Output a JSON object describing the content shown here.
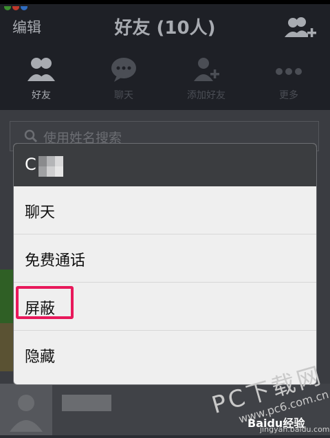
{
  "header": {
    "edit_label": "编辑",
    "title": "好友 (10人)",
    "add_friend_icon": "add-friend-icon"
  },
  "tabs": [
    {
      "label": "好友",
      "icon": "friends-icon",
      "active": true
    },
    {
      "label": "聊天",
      "icon": "chat-bubble-icon",
      "active": false
    },
    {
      "label": "添加好友",
      "icon": "add-friend-icon",
      "active": false
    },
    {
      "label": "更多",
      "icon": "more-dots-icon",
      "active": false
    }
  ],
  "search": {
    "placeholder": "使用姓名搜索"
  },
  "popup": {
    "title": "C",
    "items": [
      {
        "label": "聊天"
      },
      {
        "label": "免费通话"
      },
      {
        "label": "屏蔽"
      },
      {
        "label": "隐藏"
      }
    ],
    "highlighted_item": "屏蔽"
  },
  "watermark": {
    "line1": "PC下载网",
    "line2": "www.pc6.com.cn",
    "line3": "Baidu经验",
    "line4": "jingyan.baidu.com"
  },
  "colors": {
    "header_bg": "#1e2026",
    "highlight": "#e8185a",
    "popup_head": "#3b3d40"
  }
}
